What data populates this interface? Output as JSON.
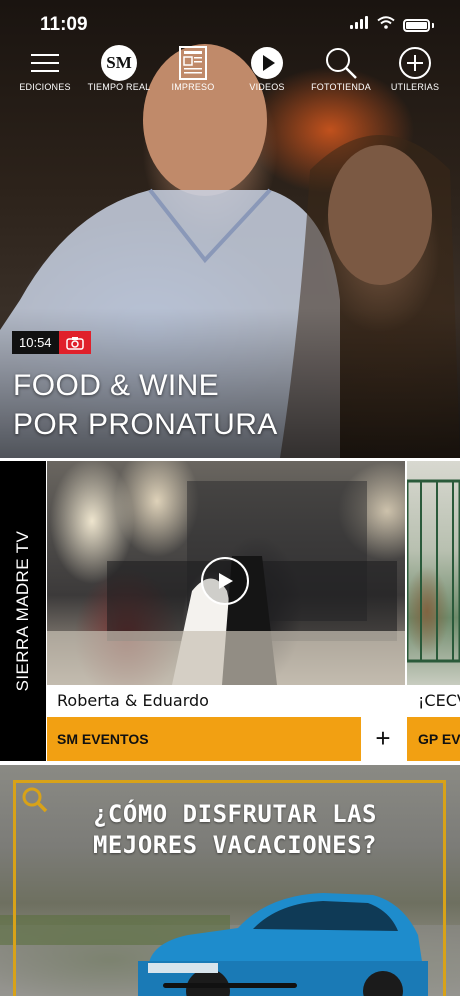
{
  "status_bar": {
    "time": "11:09"
  },
  "nav": {
    "items": [
      {
        "label": "EDICIONES",
        "icon": "menu-icon"
      },
      {
        "label": "TIEMPO REAL",
        "icon": "sm-logo-icon",
        "logo_text": "SM"
      },
      {
        "label": "IMPRESO",
        "icon": "newspaper-icon"
      },
      {
        "label": "VIDEOS",
        "icon": "play-icon"
      },
      {
        "label": "FOTOTIENDA",
        "icon": "search-icon"
      },
      {
        "label": "UTILERIAS",
        "icon": "plus-circle-icon"
      }
    ]
  },
  "hero": {
    "time": "10:54",
    "media_icon": "camera-icon",
    "title_line1": "FOOD & WINE",
    "title_line2": "POR PRONATURA"
  },
  "tv_section": {
    "label": "SIERRA MADRE TV",
    "cards": [
      {
        "caption": "Roberta & Eduardo",
        "category": "SM EVENTOS",
        "action": "+"
      },
      {
        "caption": "¡CECVA",
        "category": "GP EVEN"
      }
    ]
  },
  "promo": {
    "line1": "¿CÓMO DISFRUTAR LAS",
    "line2": "MEJORES VACACIONES?"
  },
  "colors": {
    "accent_orange": "#f2a012",
    "time_badge_red": "#e0202a",
    "promo_frame_gold": "#d8a218"
  }
}
